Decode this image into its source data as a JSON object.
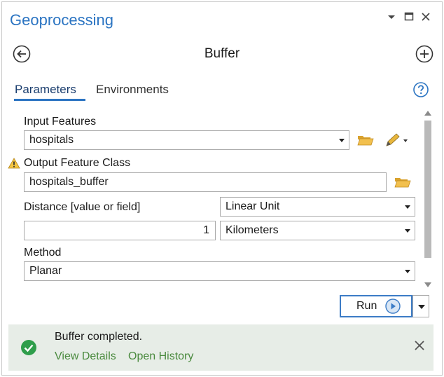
{
  "pane": {
    "title": "Geoprocessing",
    "window_controls": [
      "chevron-down-icon",
      "maximize-icon",
      "close-icon"
    ]
  },
  "tool": {
    "title": "Buffer",
    "back_icon": "back-arrow-icon",
    "add_icon": "add-circle-icon"
  },
  "tabs": [
    {
      "label": "Parameters",
      "active": true
    },
    {
      "label": "Environments",
      "active": false
    }
  ],
  "params": {
    "input_features": {
      "label": "Input Features",
      "value": "hospitals"
    },
    "output_feature_class": {
      "label": "Output Feature Class",
      "value": "hospitals_buffer",
      "warning": true
    },
    "distance": {
      "label": "Distance [value or field]",
      "type_value": "Linear Unit",
      "value": "1",
      "unit": "Kilometers"
    },
    "method": {
      "label": "Method",
      "value": "Planar"
    }
  },
  "run": {
    "label": "Run"
  },
  "status": {
    "message": "Buffer completed.",
    "links": [
      "View Details",
      "Open History"
    ]
  },
  "colors": {
    "accent": "#2b74c2",
    "status_bg": "#e7ede7",
    "success": "#2f9e4b",
    "link": "#4a8a3e",
    "warning": "#e6a817"
  }
}
